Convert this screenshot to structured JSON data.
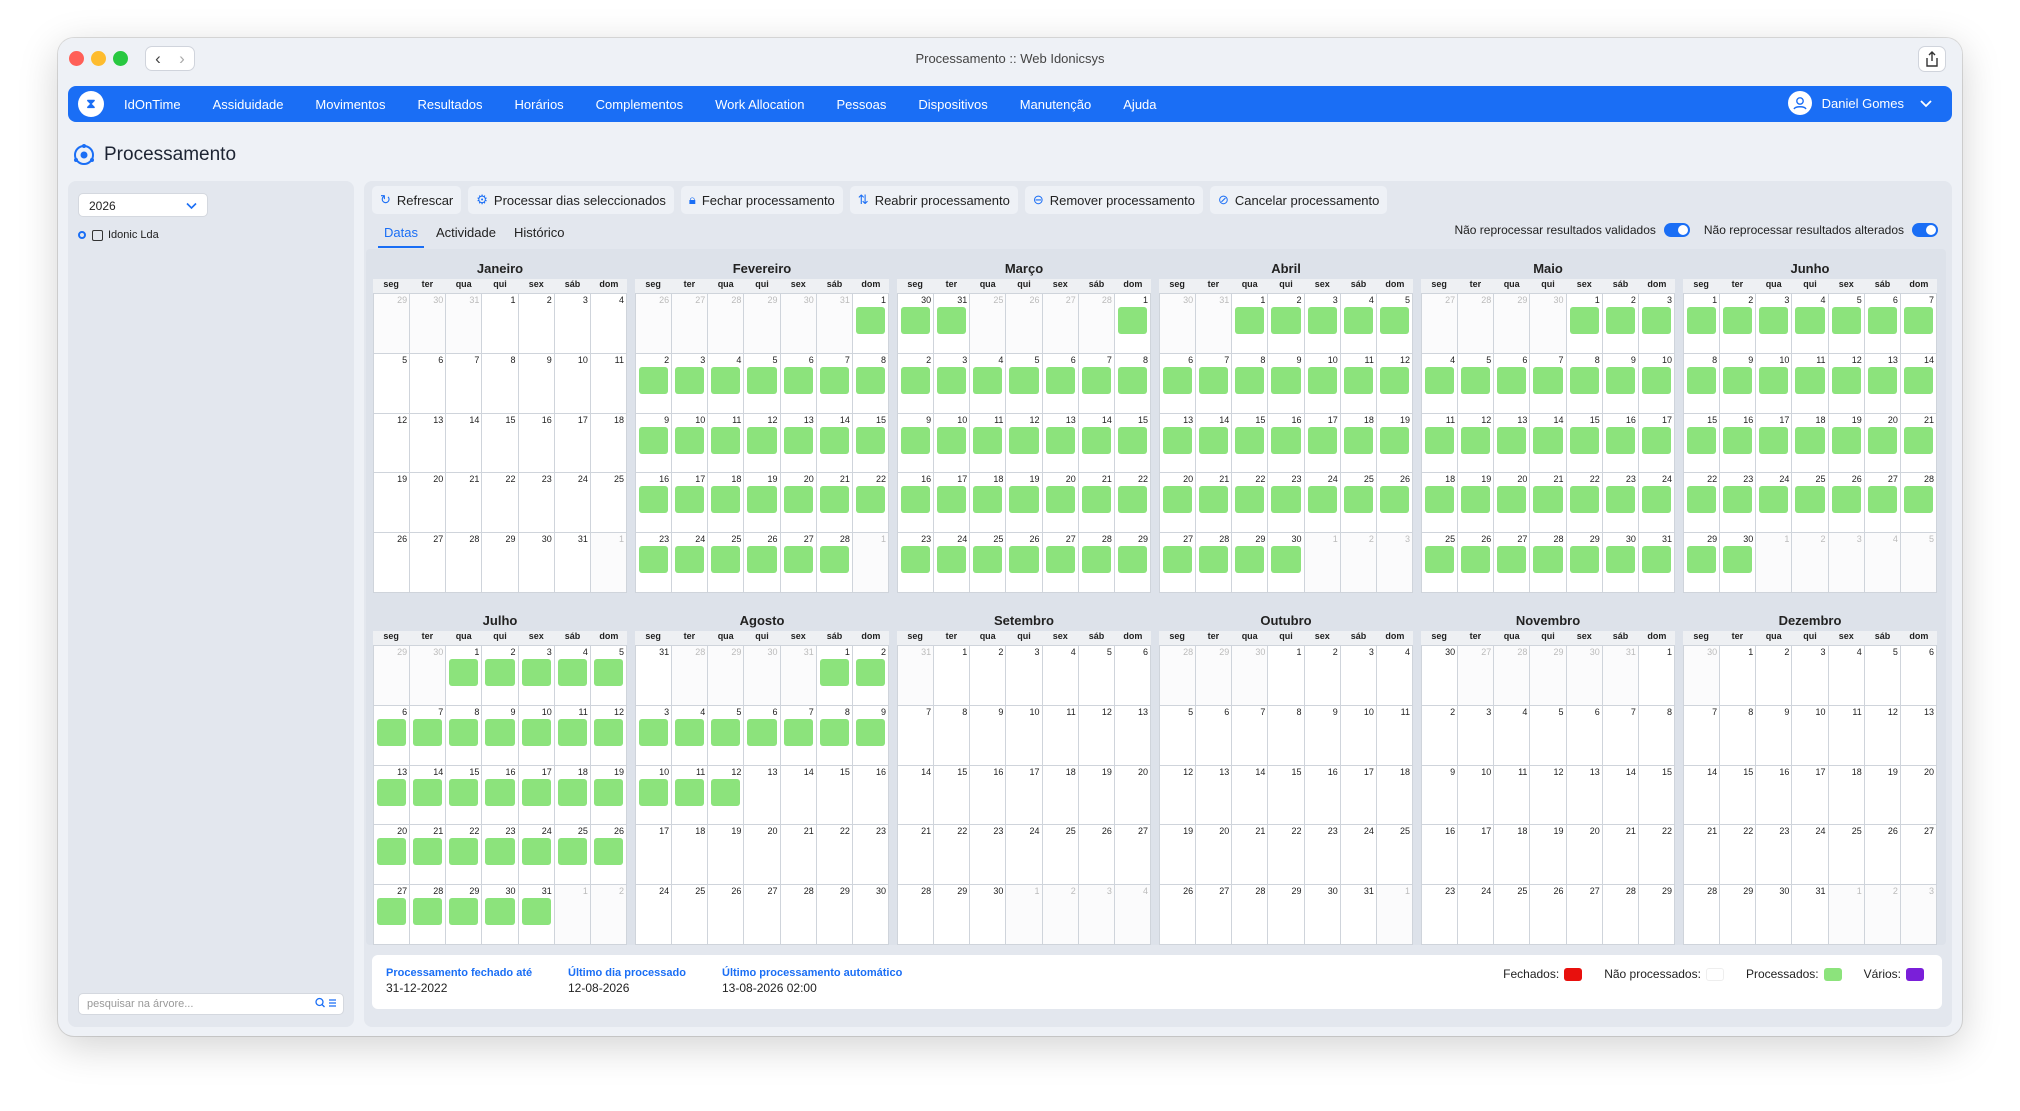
{
  "window": {
    "title": "Processamento :: Web Idonicsys"
  },
  "nav": {
    "brand_icon": "hourglass-icon",
    "items": [
      "IdOnTime",
      "Assiduidade",
      "Movimentos",
      "Resultados",
      "Horários",
      "Complementos",
      "Work Allocation",
      "Pessoas",
      "Dispositivos",
      "Manutenção",
      "Ajuda"
    ],
    "user": "Daniel Gomes"
  },
  "page": {
    "title": "Processamento"
  },
  "sidebar": {
    "year": "2026",
    "tree": [
      {
        "label": "Idonic Lda"
      }
    ],
    "search_placeholder": "pesquisar na árvore..."
  },
  "toolbar": {
    "buttons": [
      {
        "label": "Refrescar",
        "icon": "refresh-icon"
      },
      {
        "label": "Processar dias seleccionados",
        "icon": "process-icon"
      },
      {
        "label": "Fechar processamento",
        "icon": "lock-icon"
      },
      {
        "label": "Reabrir processamento",
        "icon": "reopen-icon"
      },
      {
        "label": "Remover processamento",
        "icon": "remove-icon"
      },
      {
        "label": "Cancelar processamento",
        "icon": "cancel-icon"
      }
    ]
  },
  "tabs": [
    "Datas",
    "Actividade",
    "Histórico"
  ],
  "toggles": [
    {
      "label": "Não reprocessar resultados validados",
      "on": true
    },
    {
      "label": "Não reprocessar resultados alterados",
      "on": true
    }
  ],
  "calendar": {
    "year": 2026,
    "weekdays": [
      "seg",
      "ter",
      "qua",
      "qui",
      "sex",
      "sáb",
      "dom"
    ],
    "processed_color": "#8ce37c",
    "months": [
      {
        "name": "Janeiro",
        "processed": []
      },
      {
        "name": "Fevereiro",
        "processed": [
          [
            1,
            28
          ]
        ]
      },
      {
        "name": "Março",
        "processed": [
          [
            1,
            31
          ]
        ]
      },
      {
        "name": "Abril",
        "processed": [
          [
            1,
            30
          ]
        ]
      },
      {
        "name": "Maio",
        "processed": [
          [
            1,
            31
          ]
        ]
      },
      {
        "name": "Junho",
        "processed": [
          [
            1,
            30
          ]
        ]
      },
      {
        "name": "Julho",
        "processed": [
          [
            1,
            31
          ]
        ]
      },
      {
        "name": "Agosto",
        "processed": [
          [
            1,
            12
          ]
        ]
      },
      {
        "name": "Setembro",
        "processed": []
      },
      {
        "name": "Outubro",
        "processed": []
      },
      {
        "name": "Novembro",
        "processed": []
      },
      {
        "name": "Dezembro",
        "processed": []
      }
    ]
  },
  "footer": {
    "closed_until": {
      "label": "Processamento fechado até",
      "value": "31-12-2022"
    },
    "last_day": {
      "label": "Último dia processado",
      "value": "12-08-2026"
    },
    "last_auto": {
      "label": "Último processamento automático",
      "value": "13-08-2026 02:00"
    },
    "legend": [
      {
        "label": "Fechados:",
        "color": "#e8100d"
      },
      {
        "label": "Não processados:",
        "color": "#ffffff"
      },
      {
        "label": "Processados:",
        "color": "#8ce37c"
      },
      {
        "label": "Vários:",
        "color": "#7a1fd9"
      }
    ]
  }
}
